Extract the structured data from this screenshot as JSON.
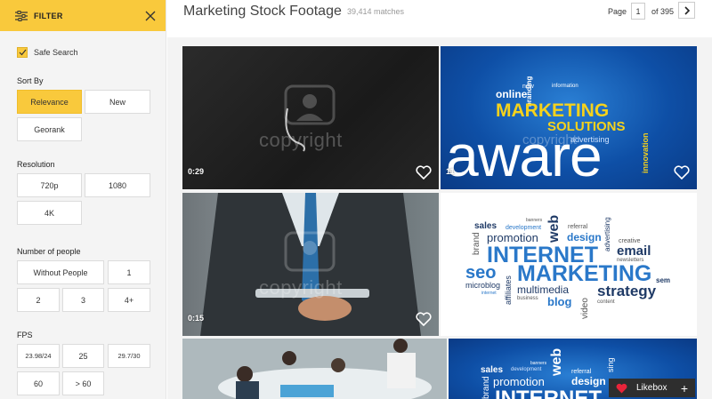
{
  "filter": {
    "title": "FILTER"
  },
  "safe_search": {
    "label": "Safe Search",
    "checked": true
  },
  "sort_by": {
    "label": "Sort By",
    "options": [
      "Relevance",
      "New",
      "Georank"
    ],
    "selected": "Relevance"
  },
  "resolution": {
    "label": "Resolution",
    "options": [
      "720p",
      "1080",
      "4K"
    ]
  },
  "people": {
    "label": "Number of people",
    "options": [
      "Without People",
      "1",
      "2",
      "3",
      "4+"
    ]
  },
  "fps": {
    "label": "FPS",
    "options": [
      "23.98/24",
      "25",
      "29.7/30",
      "60",
      "> 60"
    ]
  },
  "header": {
    "title": "Marketing Stock Footage",
    "matches": "39,414 matches",
    "page_label": "Page",
    "page_value": "1",
    "page_total": "of 395"
  },
  "tiles": [
    {
      "duration": "0:29",
      "watermark": "copyright"
    },
    {
      "duration": "11",
      "watermark": "copyright",
      "words": [
        "branding",
        "new",
        "information",
        "online",
        "MARKETING",
        "SOLUTIONS",
        "advertising",
        "innovation",
        "aware"
      ]
    },
    {
      "duration": "0:15",
      "watermark": "copyright"
    },
    {
      "words": [
        "sales",
        "banners",
        "development",
        "web",
        "referral",
        "advertising",
        "promotion",
        "design",
        "brand",
        "creative",
        "email",
        "newsletters",
        "INTERNET",
        "seo",
        "MARKETING",
        "microblog",
        "affiliates",
        "multimedia",
        "sem",
        "strategy",
        "internet",
        "blog",
        "video",
        "business",
        "content"
      ]
    },
    {
      "words": []
    },
    {
      "words": [
        "sales",
        "banners",
        "development",
        "web",
        "referral",
        "promotion",
        "design",
        "brand",
        "INTERNET",
        "sing"
      ]
    }
  ],
  "likebox": {
    "label": "Likebox",
    "plus": "+"
  },
  "colors": {
    "accent": "#f9c93c",
    "text": "#333333",
    "muted": "#999999"
  }
}
